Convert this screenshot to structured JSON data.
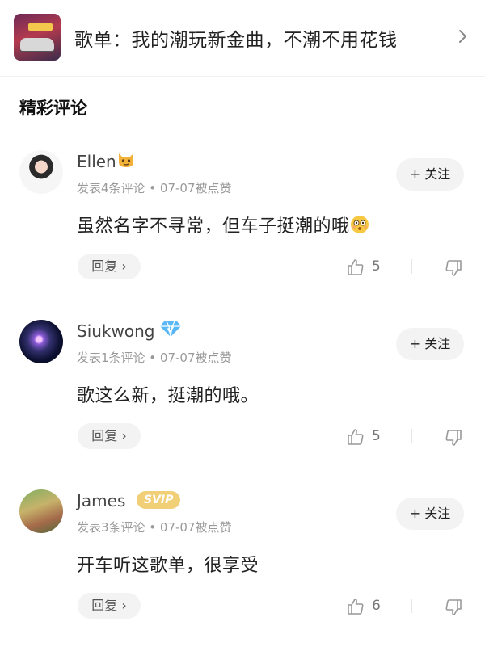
{
  "playlist": {
    "title": "歌单：我的潮玩新金曲，不潮不用花钱",
    "cover_icon": "playlist-cover-image",
    "chevron_icon": "chevron-right-icon"
  },
  "section": {
    "title": "精彩评论"
  },
  "comments": [
    {
      "username": "Ellen",
      "badge_icon": "cat-emoji-icon",
      "meta": "发表4条评论 • 07-07被点赞",
      "follow_label": "+ 关注",
      "text": "虽然名字不寻常，但车子挺潮的哦",
      "trailing_emoji": "flushed-emoji-icon",
      "reply_label": "回复 ›",
      "likes": "5"
    },
    {
      "username": "Siukwong",
      "badge_icon": "diamond-vip-icon",
      "meta": "发表1条评论 • 07-07被点赞",
      "follow_label": "+ 关注",
      "text": "歌这么新，挺潮的哦。",
      "reply_label": "回复 ›",
      "likes": "5"
    },
    {
      "username": "James",
      "badge_text": "SVIP",
      "meta": "发表3条评论 • 07-07被点赞",
      "follow_label": "+ 关注",
      "text": "开车听这歌单，很享受",
      "reply_label": "回复 ›",
      "likes": "6"
    }
  ],
  "colors": {
    "svip_badge": "#f1cf76",
    "diamond": "#58b7f5",
    "pill_bg": "#f3f3f3"
  }
}
